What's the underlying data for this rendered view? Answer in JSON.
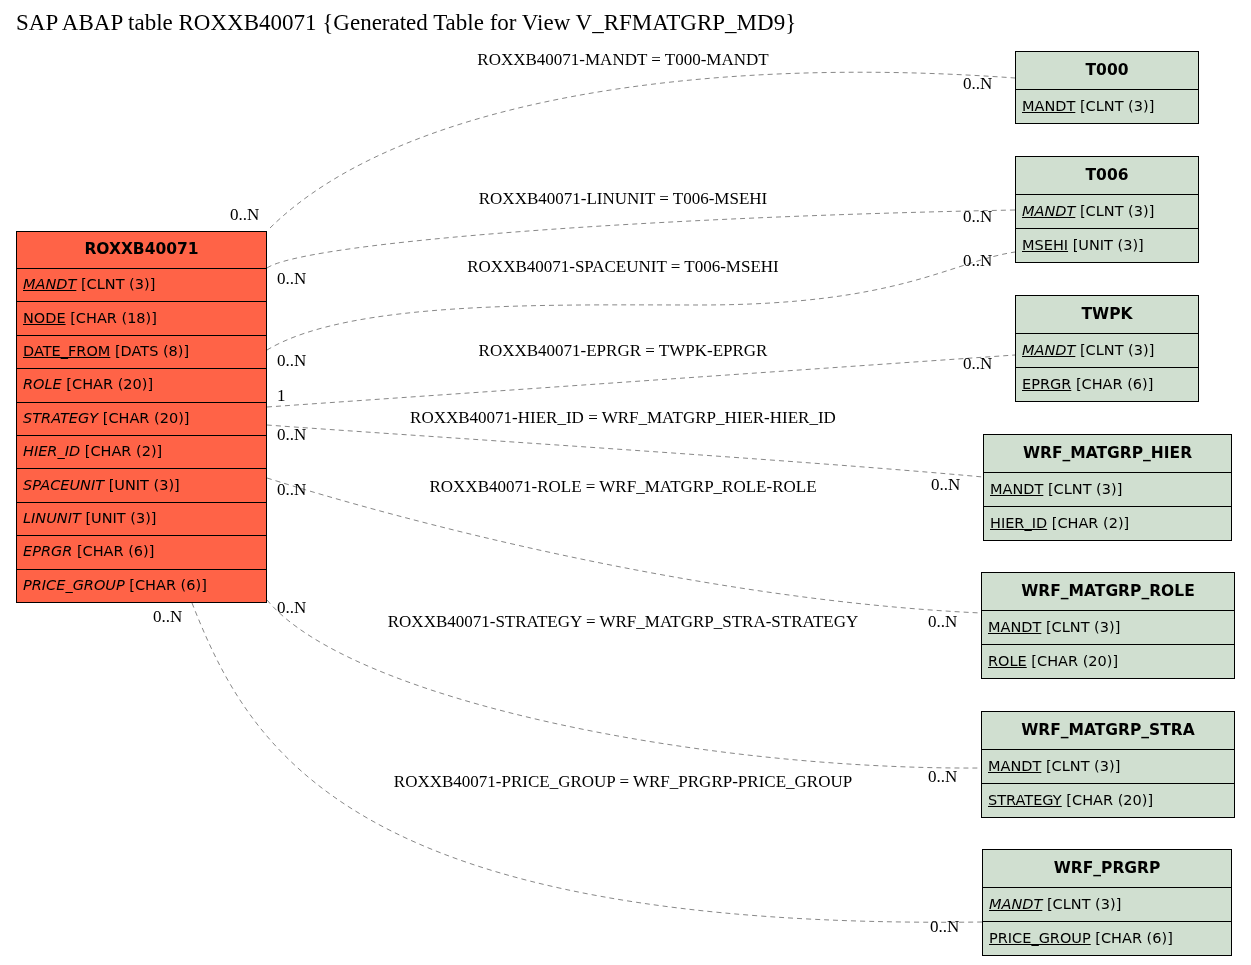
{
  "title": "SAP ABAP table ROXXB40071 {Generated Table for View V_RFMATGRP_MD9}",
  "tables": [
    {
      "kind": "main",
      "name": "ROXXB40071",
      "fields": [
        {
          "name": "MANDT",
          "type": "[CLNT (3)]",
          "key": true,
          "italic": true
        },
        {
          "name": "NODE",
          "type": "[CHAR (18)]",
          "key": true,
          "italic": false
        },
        {
          "name": "DATE_FROM",
          "type": "[DATS (8)]",
          "key": true,
          "italic": false
        },
        {
          "name": "ROLE",
          "type": "[CHAR (20)]",
          "key": false,
          "italic": true
        },
        {
          "name": "STRATEGY",
          "type": "[CHAR (20)]",
          "key": false,
          "italic": true
        },
        {
          "name": "HIER_ID",
          "type": "[CHAR (2)]",
          "key": false,
          "italic": true
        },
        {
          "name": "SPACEUNIT",
          "type": "[UNIT (3)]",
          "key": false,
          "italic": true
        },
        {
          "name": "LINUNIT",
          "type": "[UNIT (3)]",
          "key": false,
          "italic": true
        },
        {
          "name": "EPRGR",
          "type": "[CHAR (6)]",
          "key": false,
          "italic": true
        },
        {
          "name": "PRICE_GROUP",
          "type": "[CHAR (6)]",
          "key": false,
          "italic": true
        }
      ]
    },
    {
      "kind": "related",
      "name": "T000",
      "fields": [
        {
          "name": "MANDT",
          "type": "[CLNT (3)]",
          "key": true,
          "italic": false
        }
      ]
    },
    {
      "kind": "related",
      "name": "T006",
      "fields": [
        {
          "name": "MANDT",
          "type": "[CLNT (3)]",
          "key": true,
          "italic": true
        },
        {
          "name": "MSEHI",
          "type": "[UNIT (3)]",
          "key": true,
          "italic": false
        }
      ]
    },
    {
      "kind": "related",
      "name": "TWPK",
      "fields": [
        {
          "name": "MANDT",
          "type": "[CLNT (3)]",
          "key": true,
          "italic": true
        },
        {
          "name": "EPRGR",
          "type": "[CHAR (6)]",
          "key": true,
          "italic": false
        }
      ]
    },
    {
      "kind": "related",
      "name": "WRF_MATGRP_HIER",
      "fields": [
        {
          "name": "MANDT",
          "type": "[CLNT (3)]",
          "key": true,
          "italic": false
        },
        {
          "name": "HIER_ID",
          "type": "[CHAR (2)]",
          "key": true,
          "italic": false
        }
      ]
    },
    {
      "kind": "related",
      "name": "WRF_MATGRP_ROLE",
      "fields": [
        {
          "name": "MANDT",
          "type": "[CLNT (3)]",
          "key": true,
          "italic": false
        },
        {
          "name": "ROLE",
          "type": "[CHAR (20)]",
          "key": true,
          "italic": false
        }
      ]
    },
    {
      "kind": "related",
      "name": "WRF_MATGRP_STRA",
      "fields": [
        {
          "name": "MANDT",
          "type": "[CLNT (3)]",
          "key": true,
          "italic": false
        },
        {
          "name": "STRATEGY",
          "type": "[CHAR (20)]",
          "key": true,
          "italic": false
        }
      ]
    },
    {
      "kind": "related",
      "name": "WRF_PRGRP",
      "fields": [
        {
          "name": "MANDT",
          "type": "[CLNT (3)]",
          "key": true,
          "italic": true
        },
        {
          "name": "PRICE_GROUP",
          "type": "[CHAR (6)]",
          "key": true,
          "italic": false
        }
      ]
    }
  ],
  "relations": [
    {
      "label": "ROXXB40071-MANDT = T000-MANDT",
      "source_cardinality": "0..N",
      "target_cardinality": "0..N"
    },
    {
      "label": "ROXXB40071-LINUNIT = T006-MSEHI",
      "source_cardinality": "0..N",
      "target_cardinality": "0..N"
    },
    {
      "label": "ROXXB40071-SPACEUNIT = T006-MSEHI",
      "source_cardinality": "0..N",
      "target_cardinality": "0..N"
    },
    {
      "label": "ROXXB40071-EPRGR = TWPK-EPRGR",
      "source_cardinality": "1",
      "target_cardinality": "0..N"
    },
    {
      "label": "ROXXB40071-HIER_ID = WRF_MATGRP_HIER-HIER_ID",
      "source_cardinality": "0..N",
      "target_cardinality": "0..N"
    },
    {
      "label": "ROXXB40071-ROLE = WRF_MATGRP_ROLE-ROLE",
      "source_cardinality": "0..N",
      "target_cardinality": "0..N"
    },
    {
      "label": "ROXXB40071-STRATEGY = WRF_MATGRP_STRA-STRATEGY",
      "source_cardinality": "0..N",
      "target_cardinality": "0..N"
    },
    {
      "label": "ROXXB40071-PRICE_GROUP = WRF_PRGRP-PRICE_GROUP",
      "source_cardinality": "0..N",
      "target_cardinality": "0..N"
    }
  ]
}
